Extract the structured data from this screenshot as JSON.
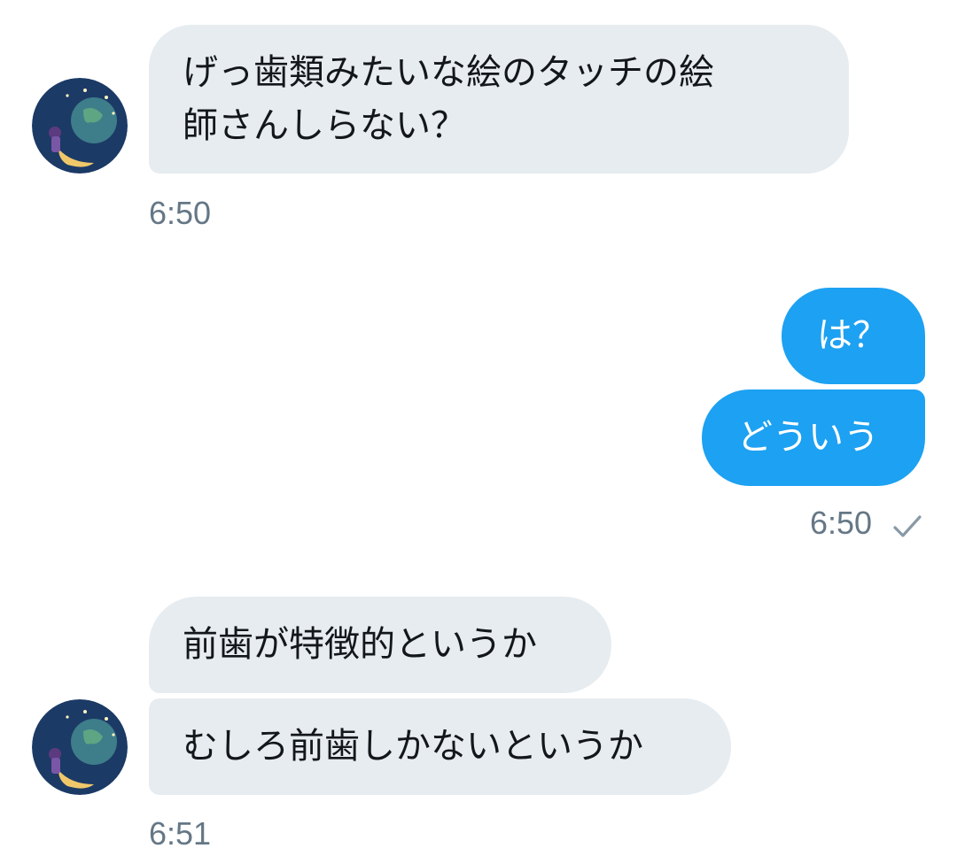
{
  "conversation": {
    "group1": {
      "messages": [
        "げっ歯類みたいな絵のタッチの絵\n師さんしらない？"
      ],
      "time": "6:50"
    },
    "group2": {
      "messages": [
        "は？",
        "どういう"
      ],
      "time": "6:50",
      "status_icon": "checkmark-icon"
    },
    "group3": {
      "messages": [
        "前歯が特徴的というか",
        "むしろ前歯しかないというか"
      ],
      "time": "6:51"
    }
  },
  "colors": {
    "incoming_bubble": "#e6ecf0",
    "outgoing_bubble": "#1da1f2",
    "timestamp": "#657786"
  },
  "avatar_icon": "moon-avatar-icon"
}
